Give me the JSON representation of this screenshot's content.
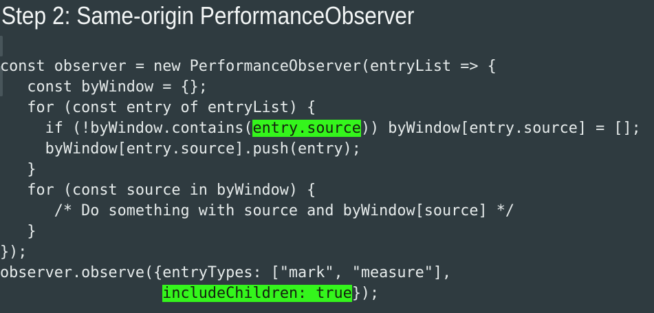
{
  "slide": {
    "title": "Step 2: Same-origin PerformanceObserver"
  },
  "code": {
    "highlight_color": "#34f51c",
    "background_color": "#2f3b40",
    "lines": [
      {
        "pre": "const observer = new PerformanceObserver(entryList => {",
        "hl": "",
        "post": ""
      },
      {
        "pre": "   const byWindow = {};",
        "hl": "",
        "post": ""
      },
      {
        "pre": "   for (const entry of entryList) {",
        "hl": "",
        "post": ""
      },
      {
        "pre": "     if (!byWindow.contains(",
        "hl": "entry.source",
        "post": ")) byWindow[entry.source] = [];"
      },
      {
        "pre": "     byWindow[entry.source].push(entry);",
        "hl": "",
        "post": ""
      },
      {
        "pre": "   }",
        "hl": "",
        "post": ""
      },
      {
        "pre": "   for (const source in byWindow) {",
        "hl": "",
        "post": ""
      },
      {
        "pre": "      /* Do something with source and byWindow[source] */",
        "hl": "",
        "post": ""
      },
      {
        "pre": "   }",
        "hl": "",
        "post": ""
      },
      {
        "pre": "});",
        "hl": "",
        "post": ""
      },
      {
        "pre": "observer.observe({entryTypes: [\"mark\", \"measure\"],",
        "hl": "",
        "post": ""
      },
      {
        "pre": "                  ",
        "hl": "includeChildren: true",
        "post": "});"
      }
    ]
  }
}
